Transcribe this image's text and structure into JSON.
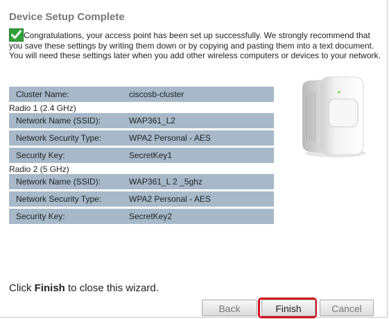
{
  "title": "Device Setup Complete",
  "intro": "Congratulations, your access point has been set up successfully. We strongly recommend that you save these settings by writing them down or by copying and pasting them into a text document. You will need these settings later when you add other wireless computers or devices to your network.",
  "cluster": {
    "label": "Cluster Name:",
    "value": "ciscosb-cluster"
  },
  "radio1": {
    "heading": "Radio 1 (2.4 GHz)",
    "ssid": {
      "label": "Network Name (SSID):",
      "value": "WAP361_L2"
    },
    "security_type": {
      "label": "Network Security Type:",
      "value": "WPA2 Personal - AES"
    },
    "key": {
      "label": "Security Key:",
      "value": "SecretKey1"
    }
  },
  "radio2": {
    "heading": "Radio 2 (5 GHz)",
    "ssid": {
      "label": "Network Name (SSID):",
      "value": "WAP361_L 2 _5ghz"
    },
    "security_type": {
      "label": "Network Security Type:",
      "value": "WPA2 Personal - AES"
    },
    "key": {
      "label": "Security Key:",
      "value": "SecretKey2"
    }
  },
  "footer": {
    "prefix": "Click ",
    "bold": "Finish",
    "suffix": " to close this wizard."
  },
  "buttons": {
    "back": "Back",
    "finish": "Finish",
    "cancel": "Cancel"
  },
  "colors": {
    "row_bg": "#a7b9c9",
    "highlight": "#d0121f",
    "check_green": "#31a13a"
  },
  "icons": {
    "success": "checkmark-icon",
    "device": "access-point-image"
  }
}
